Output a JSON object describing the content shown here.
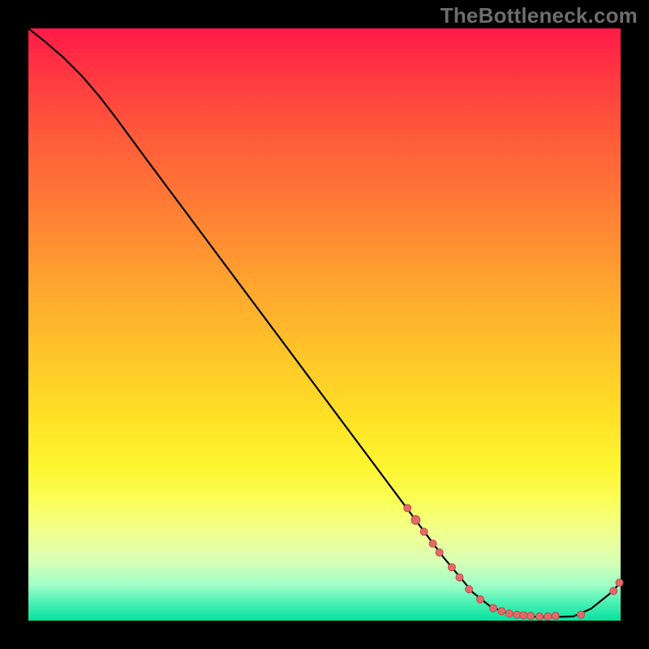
{
  "watermark": "TheBottleneck.com",
  "colors": {
    "marker_fill": "#e46a6a",
    "marker_stroke": "#b94d4d",
    "curve": "#000000",
    "background": "#000000"
  },
  "chart_data": {
    "type": "line",
    "title": "",
    "xlabel": "",
    "ylabel": "",
    "xlim": [
      0,
      100
    ],
    "ylim": [
      0,
      100
    ],
    "grid": false,
    "legend_visible": false,
    "curve_points": [
      {
        "x": 0.0,
        "y": 100.0
      },
      {
        "x": 3.0,
        "y": 97.6
      },
      {
        "x": 6.0,
        "y": 95.0
      },
      {
        "x": 9.0,
        "y": 92.0
      },
      {
        "x": 12.0,
        "y": 88.5
      },
      {
        "x": 15.0,
        "y": 84.6
      },
      {
        "x": 20.0,
        "y": 77.8
      },
      {
        "x": 30.0,
        "y": 64.4
      },
      {
        "x": 40.0,
        "y": 51.0
      },
      {
        "x": 50.0,
        "y": 37.6
      },
      {
        "x": 60.0,
        "y": 24.2
      },
      {
        "x": 70.0,
        "y": 10.8
      },
      {
        "x": 75.0,
        "y": 4.8
      },
      {
        "x": 78.0,
        "y": 2.4
      },
      {
        "x": 81.0,
        "y": 1.2
      },
      {
        "x": 84.0,
        "y": 0.7
      },
      {
        "x": 88.0,
        "y": 0.6
      },
      {
        "x": 92.0,
        "y": 0.7
      },
      {
        "x": 95.0,
        "y": 2.0
      },
      {
        "x": 98.0,
        "y": 4.4
      },
      {
        "x": 100.0,
        "y": 6.4
      }
    ],
    "markers": [
      {
        "x": 64.0,
        "y": 19.0,
        "r": 4.5
      },
      {
        "x": 65.4,
        "y": 17.0,
        "r": 5.4
      },
      {
        "x": 66.8,
        "y": 15.0,
        "r": 4.5
      },
      {
        "x": 68.3,
        "y": 13.0,
        "r": 4.5
      },
      {
        "x": 69.4,
        "y": 11.5,
        "r": 4.5
      },
      {
        "x": 71.5,
        "y": 9.0,
        "r": 4.5
      },
      {
        "x": 72.8,
        "y": 7.3,
        "r": 4.5
      },
      {
        "x": 74.4,
        "y": 5.3,
        "r": 4.5
      },
      {
        "x": 76.3,
        "y": 3.6,
        "r": 4.5
      },
      {
        "x": 78.5,
        "y": 2.1,
        "r": 4.5
      },
      {
        "x": 79.9,
        "y": 1.6,
        "r": 4.5
      },
      {
        "x": 81.2,
        "y": 1.2,
        "r": 4.5
      },
      {
        "x": 82.5,
        "y": 1.0,
        "r": 4.5
      },
      {
        "x": 83.6,
        "y": 0.9,
        "r": 4.5
      },
      {
        "x": 84.8,
        "y": 0.8,
        "r": 4.5
      },
      {
        "x": 86.3,
        "y": 0.7,
        "r": 4.5
      },
      {
        "x": 87.7,
        "y": 0.7,
        "r": 4.5
      },
      {
        "x": 89.0,
        "y": 0.8,
        "r": 4.5
      },
      {
        "x": 93.3,
        "y": 1.0,
        "r": 4.5
      },
      {
        "x": 98.8,
        "y": 5.0,
        "r": 4.5
      },
      {
        "x": 99.8,
        "y": 6.4,
        "r": 4.5
      }
    ]
  }
}
